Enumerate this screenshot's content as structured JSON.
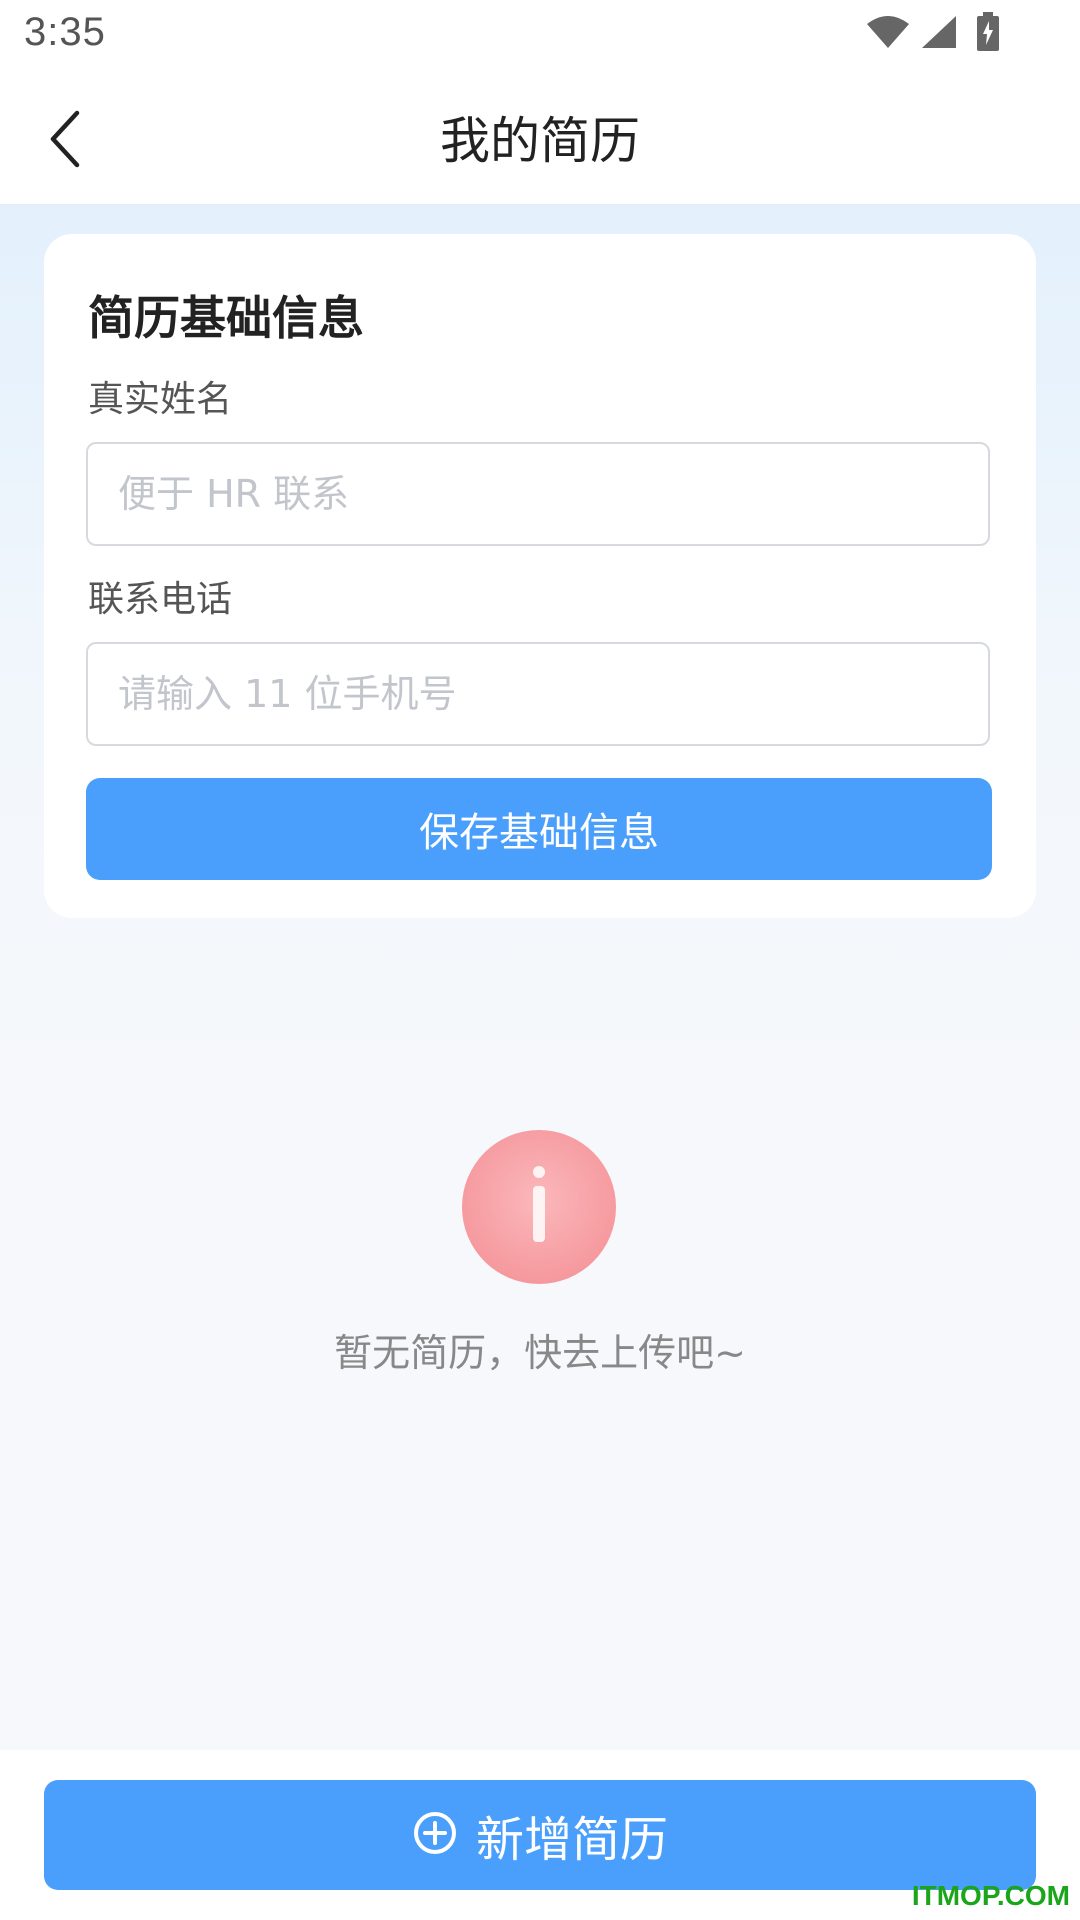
{
  "status_bar": {
    "time": "3:35",
    "icons": [
      "wifi-icon",
      "cellular-signal-icon",
      "battery-charging-icon"
    ]
  },
  "header": {
    "title": "我的简历",
    "back_icon": "chevron-left-icon"
  },
  "basic_info_card": {
    "title": "简历基础信息",
    "name_field": {
      "label": "真实姓名",
      "value": "",
      "placeholder": "便于 HR 联系"
    },
    "phone_field": {
      "label": "联系电话",
      "value": "",
      "placeholder": "请输入 11 位手机号"
    },
    "save_button_label": "保存基础信息"
  },
  "empty_state": {
    "icon": "info-icon",
    "message": "暂无简历，快去上传吧~"
  },
  "bottom_bar": {
    "add_button_icon": "plus-circle-icon",
    "add_button_label": "新增简历"
  },
  "watermark": "ITMOP.COM",
  "colors": {
    "primary": "#4a9ffd",
    "empty_icon": "#f7a3a7",
    "watermark": "#1aa51a"
  }
}
